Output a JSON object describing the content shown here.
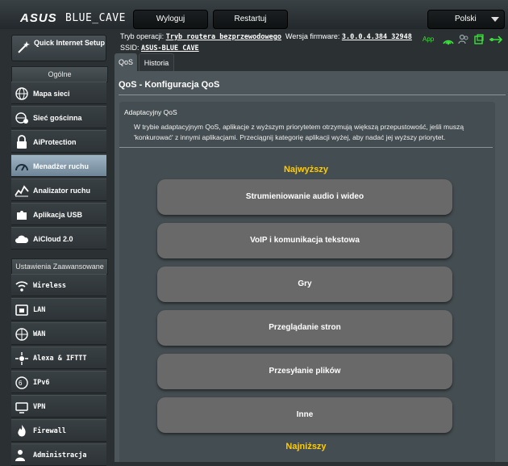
{
  "header": {
    "logo": "ASUS",
    "model": "BLUE_CAVE",
    "logout_label": "Wyloguj",
    "restart_label": "Restartuj",
    "language": "Polski"
  },
  "status": {
    "mode_label": "Tryb operacji:",
    "mode_value": "Tryb routera bezprzewodowego",
    "firmware_label": "Wersja firmware:",
    "firmware_value": "3.0.0.4.384_32948",
    "ssid_label": "SSID:",
    "ssid_value": "ASUS-BLUE_CAVE",
    "app_label": "App"
  },
  "sidebar": {
    "qis_label": "Quick Internet Setup",
    "general_header": "Ogólne",
    "general_items": [
      {
        "label": "Mapa sieci",
        "icon": "network-map-icon"
      },
      {
        "label": "Sieć gościnna",
        "icon": "guest-network-icon"
      },
      {
        "label": "AiProtection",
        "icon": "aiprotection-icon"
      },
      {
        "label": "Menadżer ruchu",
        "icon": "traffic-manager-icon"
      },
      {
        "label": "Analizator ruchu",
        "icon": "traffic-analyzer-icon"
      },
      {
        "label": "Aplikacja USB",
        "icon": "usb-app-icon"
      },
      {
        "label": "AiCloud 2.0",
        "icon": "aicloud-icon"
      }
    ],
    "advanced_header": "Ustawienia Zaawansowane",
    "advanced_items": [
      {
        "label": "Wireless",
        "icon": "wireless-icon"
      },
      {
        "label": "LAN",
        "icon": "lan-icon"
      },
      {
        "label": "WAN",
        "icon": "wan-icon"
      },
      {
        "label": "Alexa & IFTTT",
        "icon": "alexa-icon"
      },
      {
        "label": "IPv6",
        "icon": "ipv6-icon"
      },
      {
        "label": "VPN",
        "icon": "vpn-icon"
      },
      {
        "label": "Firewall",
        "icon": "firewall-icon"
      },
      {
        "label": "Administracja",
        "icon": "administration-icon"
      }
    ]
  },
  "tabs": [
    {
      "label": "QoS"
    },
    {
      "label": "Historia"
    }
  ],
  "main": {
    "title": "QoS - Konfiguracja QoS",
    "panel_title": "Adaptacyjny QoS",
    "description": "W trybie adaptacyjnym QoS, aplikacje z wyższym priorytetem otrzymują większą przepustowość, jeśli muszą 'konkurować' z innymi aplikacjami. Przeciągnij kategorię aplikacji wyżej, aby nadać jej wyższy priorytet.",
    "highest_label": "Najwyższy",
    "lowest_label": "Najniższy",
    "categories": [
      {
        "label": "Strumieniowanie audio i wideo"
      },
      {
        "label": "VoIP i komunikacja tekstowa"
      },
      {
        "label": "Gry"
      },
      {
        "label": "Przeglądanie stron"
      },
      {
        "label": "Przesyłanie plików"
      },
      {
        "label": "Inne"
      }
    ]
  },
  "colors": {
    "accent_priority": "#ffcc00",
    "app_green": "#3ae13a",
    "category_bg": "#696969"
  }
}
